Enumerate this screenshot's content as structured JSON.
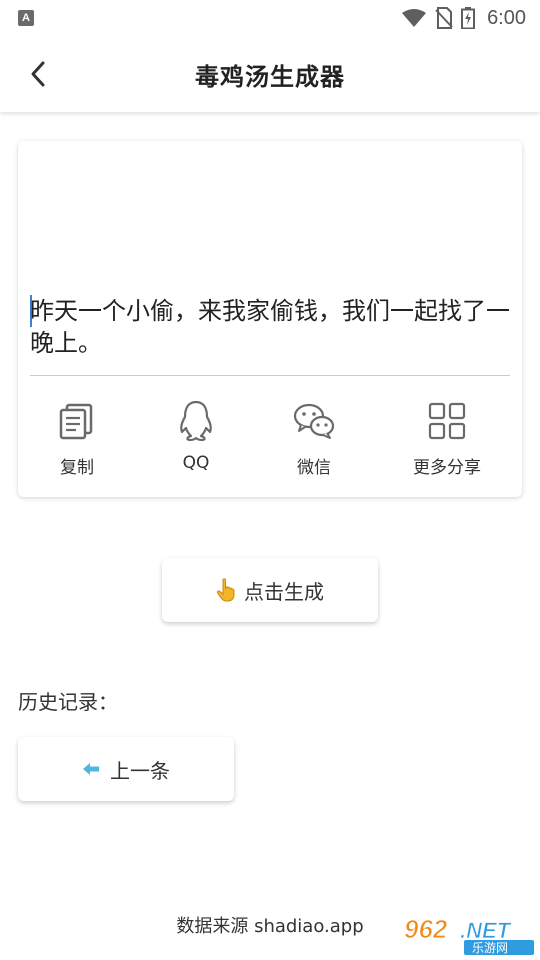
{
  "status_bar": {
    "notification_icon": "A",
    "time": "6:00",
    "icons": [
      "wifi-icon",
      "no-sim-icon",
      "battery-charging-icon"
    ]
  },
  "header": {
    "title": "毒鸡汤生成器",
    "back_icon": "chevron-left-icon"
  },
  "card": {
    "quote": "昨天一个小偷，来我家偷钱，我们一起找了一晚上。",
    "share_items": [
      {
        "label": "复制",
        "icon": "copy-icon"
      },
      {
        "label": "QQ",
        "icon": "qq-icon"
      },
      {
        "label": "微信",
        "icon": "wechat-icon"
      },
      {
        "label": "更多分享",
        "icon": "grid-icon"
      }
    ]
  },
  "generate_button": {
    "label": "点击生成",
    "icon": "pointing-hand-icon"
  },
  "history": {
    "title": "历史记录：",
    "prev_button": {
      "label": "上一条",
      "icon": "arrow-left-icon"
    }
  },
  "footer": {
    "source": "数据来源 shadiao.app"
  },
  "watermark": {
    "text": "962.NET",
    "subtext": "乐游网"
  },
  "colors": {
    "accent_blue": "#4fb6e0",
    "caret_blue": "#3f7fd6",
    "hand_yellow": "#f5b428"
  }
}
